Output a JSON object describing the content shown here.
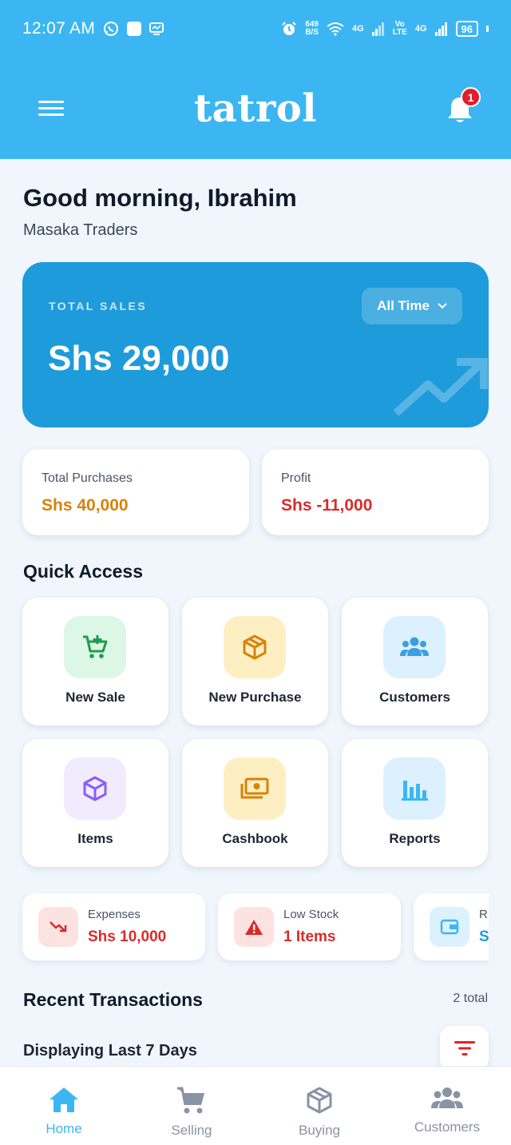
{
  "status_bar": {
    "time": "12:07 AM",
    "net_speed_top": "649",
    "net_speed_bottom": "B/S",
    "signal1": "4G",
    "volte_top": "Vo",
    "volte_bottom": "LTE",
    "signal2": "4G",
    "battery": "96"
  },
  "header": {
    "logo": "tatrol",
    "notification_count": "1"
  },
  "greeting": {
    "title": "Good morning, Ibrahim",
    "business": "Masaka Traders"
  },
  "sales_card": {
    "label": "TOTAL SALES",
    "value": "Shs 29,000",
    "period": "All Time"
  },
  "stats": [
    {
      "label": "Total Purchases",
      "value": "Shs 40,000",
      "color": "#d9820a"
    },
    {
      "label": "Profit",
      "value": "Shs -11,000",
      "color": "#d92b2b"
    }
  ],
  "quick_access": {
    "title": "Quick Access",
    "tiles": [
      {
        "label": "New Sale",
        "icon": "cart-plus-icon"
      },
      {
        "label": "New Purchase",
        "icon": "box-icon"
      },
      {
        "label": "Customers",
        "icon": "users-icon"
      },
      {
        "label": "Items",
        "icon": "cube-icon"
      },
      {
        "label": "Cashbook",
        "icon": "money-icon"
      },
      {
        "label": "Reports",
        "icon": "bar-chart-icon"
      }
    ]
  },
  "summary": [
    {
      "label": "Expenses",
      "value": "Shs 10,000",
      "color": "#d92b2b",
      "icon": "trend-down-icon"
    },
    {
      "label": "Low Stock",
      "value": "1 Items",
      "color": "#d92b2b",
      "icon": "warning-icon"
    },
    {
      "label": "R",
      "value": "S",
      "color": "#1e9bdb",
      "icon": "wallet-icon"
    }
  ],
  "recent": {
    "title": "Recent Transactions",
    "count": "2 total",
    "subtitle": "Displaying Last 7 Days"
  },
  "nav": [
    {
      "label": "Home",
      "icon": "home-icon",
      "active": true
    },
    {
      "label": "Selling",
      "icon": "cart-icon",
      "active": false
    },
    {
      "label": "Buying",
      "icon": "box-icon",
      "active": false
    },
    {
      "label": "Customers",
      "icon": "users-icon",
      "active": false
    }
  ],
  "colors": {
    "primary": "#3bb6f3",
    "card_blue": "#1e9bdb",
    "orange": "#d9820a",
    "red": "#d92b2b"
  }
}
